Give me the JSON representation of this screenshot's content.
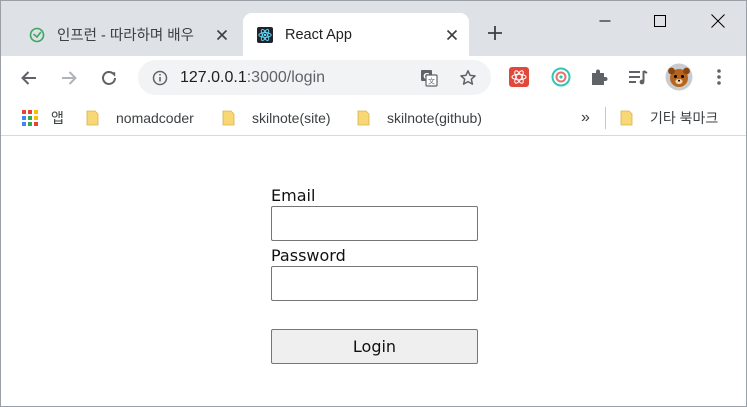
{
  "browser": {
    "tabs": [
      {
        "title": "인프런 - 따라하며 배우",
        "icon": "inflearn-favicon",
        "active": false
      },
      {
        "title": "React App",
        "icon": "react-favicon",
        "active": true
      }
    ],
    "url": {
      "host": "127.0.0.1",
      "rest": ":3000/login"
    },
    "bookmarks": {
      "apps_label": "앱",
      "items": [
        "nomadcoder",
        "skilnote(site)",
        "skilnote(github)"
      ],
      "overflow": "»",
      "other_label": "기타 북마크"
    },
    "extensions": [
      "react-devtools-icon",
      "redux-devtools-icon",
      "puzzle-icon",
      "media-queue-icon",
      "profile-avatar"
    ],
    "colors": {
      "tabstrip": "#dee1e6",
      "omnibox": "#f1f3f4",
      "folder": "#f8d775"
    }
  },
  "page": {
    "email_label": "Email",
    "email_value": "",
    "password_label": "Password",
    "password_value": "",
    "login_button": "Login"
  }
}
